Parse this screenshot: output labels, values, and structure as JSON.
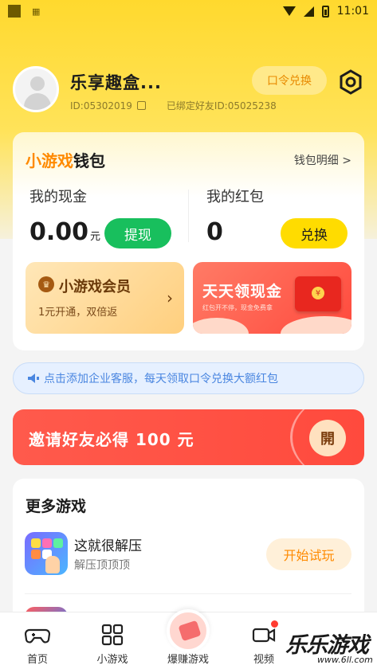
{
  "status_bar": {
    "time": "11:01"
  },
  "profile": {
    "nickname": "乐享趣盒...",
    "user_id": "ID:05302019",
    "bound_friend": "已绑定好友ID:05025238",
    "redeem_code_label": "口令兑换"
  },
  "wallet": {
    "title_part1": "小游戏",
    "title_part2": "钱包",
    "detail_link": "钱包明细 >",
    "cash_label": "我的现金",
    "cash_amount": "0.00",
    "cash_unit": "元",
    "withdraw_label": "提现",
    "redpacket_label": "我的红包",
    "redpacket_amount": "0",
    "exchange_label": "兑换",
    "vip": {
      "title": "小游戏会员",
      "subtitle": "1元开通，双倍返"
    },
    "cash_promo": {
      "title": "天天领现金",
      "subtitle": "红包开不停，现金免费拿"
    }
  },
  "notice": {
    "text": "点击添加企业客服，每天领取口令兑换大额红包"
  },
  "invite": {
    "text": "邀请好友必得 100 元",
    "open_label": "開"
  },
  "more_games": {
    "title": "更多游戏",
    "games": [
      {
        "name": "这就很解压",
        "desc": "解压顶顶顶",
        "action": "开始试玩"
      }
    ]
  },
  "tabbar": {
    "tabs": [
      {
        "label": "首页"
      },
      {
        "label": "小游戏"
      },
      {
        "label": "爆赚游戏"
      },
      {
        "label": "视频"
      }
    ]
  },
  "watermark": {
    "text": "乐乐游戏",
    "url": "www.6ll.com"
  },
  "colors": {
    "brand_yellow": "#ffd92e",
    "green": "#18bf5d",
    "orange": "#ff8a00",
    "red": "#ff4a3d",
    "blue": "#4a86e0"
  }
}
